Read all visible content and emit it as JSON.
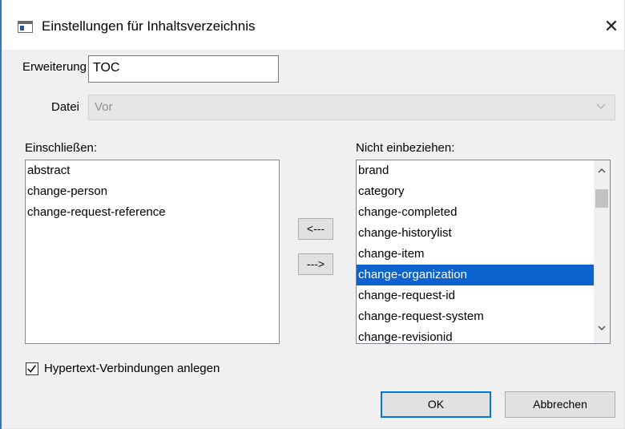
{
  "window": {
    "title": "Einstellungen für Inhaltsverzeichnis",
    "close_glyph": "✕"
  },
  "fields": {
    "extension_label": "Erweiterung:",
    "extension_value": "TOC",
    "file_label": "Datei",
    "file_value": "Vor"
  },
  "include": {
    "label": "Einschließen:",
    "items": [
      "abstract",
      "change-person",
      "change-request-reference"
    ]
  },
  "exclude": {
    "label": "Nicht einbeziehen:",
    "items": [
      "brand",
      "category",
      "change-completed",
      "change-historylist",
      "change-item",
      "change-organization",
      "change-request-id",
      "change-request-system",
      "change-revisionid"
    ],
    "selected": "change-organization"
  },
  "move_buttons": {
    "to_include": "<---",
    "to_exclude": "--->"
  },
  "checkbox": {
    "label": "Hypertext-Verbindungen anlegen",
    "checked": true
  },
  "buttons": {
    "ok": "OK",
    "cancel": "Abbrechen"
  },
  "colors": {
    "selection": "#0c63cf",
    "default_button_border": "#0078d7",
    "accent_edge": "#2b79d6"
  }
}
